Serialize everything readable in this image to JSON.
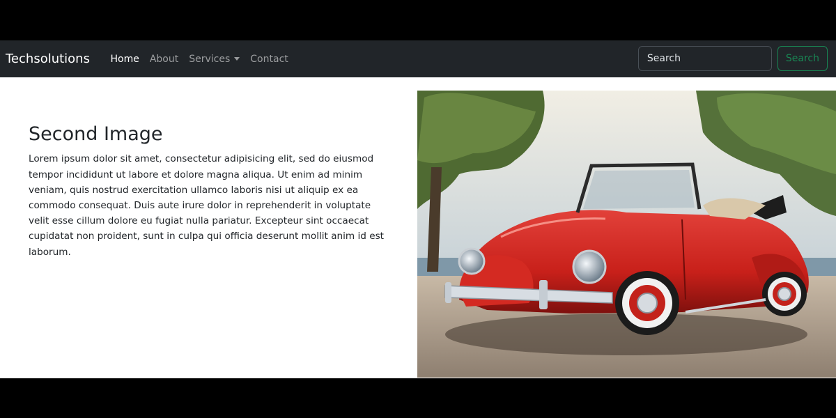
{
  "navbar": {
    "brand": "Techsolutions",
    "links": [
      {
        "label": "Home",
        "active": true
      },
      {
        "label": "About",
        "active": false
      },
      {
        "label": "Services",
        "active": false,
        "dropdown": true
      },
      {
        "label": "Contact",
        "active": false
      }
    ],
    "search": {
      "placeholder": "Search",
      "button_label": "Search"
    }
  },
  "main": {
    "heading": "Second Image",
    "paragraph": "Lorem ipsum dolor sit amet, consectetur adipisicing elit, sed do eiusmod tempor incididunt ut labore et dolore magna aliqua. Ut enim ad minim veniam, quis nostrud exercitation ullamco laboris nisi ut aliquip ex ea commodo consequat. Duis aute irure dolor in reprehenderit in voluptate velit esse cillum dolore eu fugiat nulla pariatur. Excepteur sint occaecat cupidatat non proident, sunt in culpa qui officia deserunt mollit anim id est laborum."
  },
  "colors": {
    "navbar_bg": "#212529",
    "search_button": "#198754",
    "car_body": "#c8201a"
  }
}
